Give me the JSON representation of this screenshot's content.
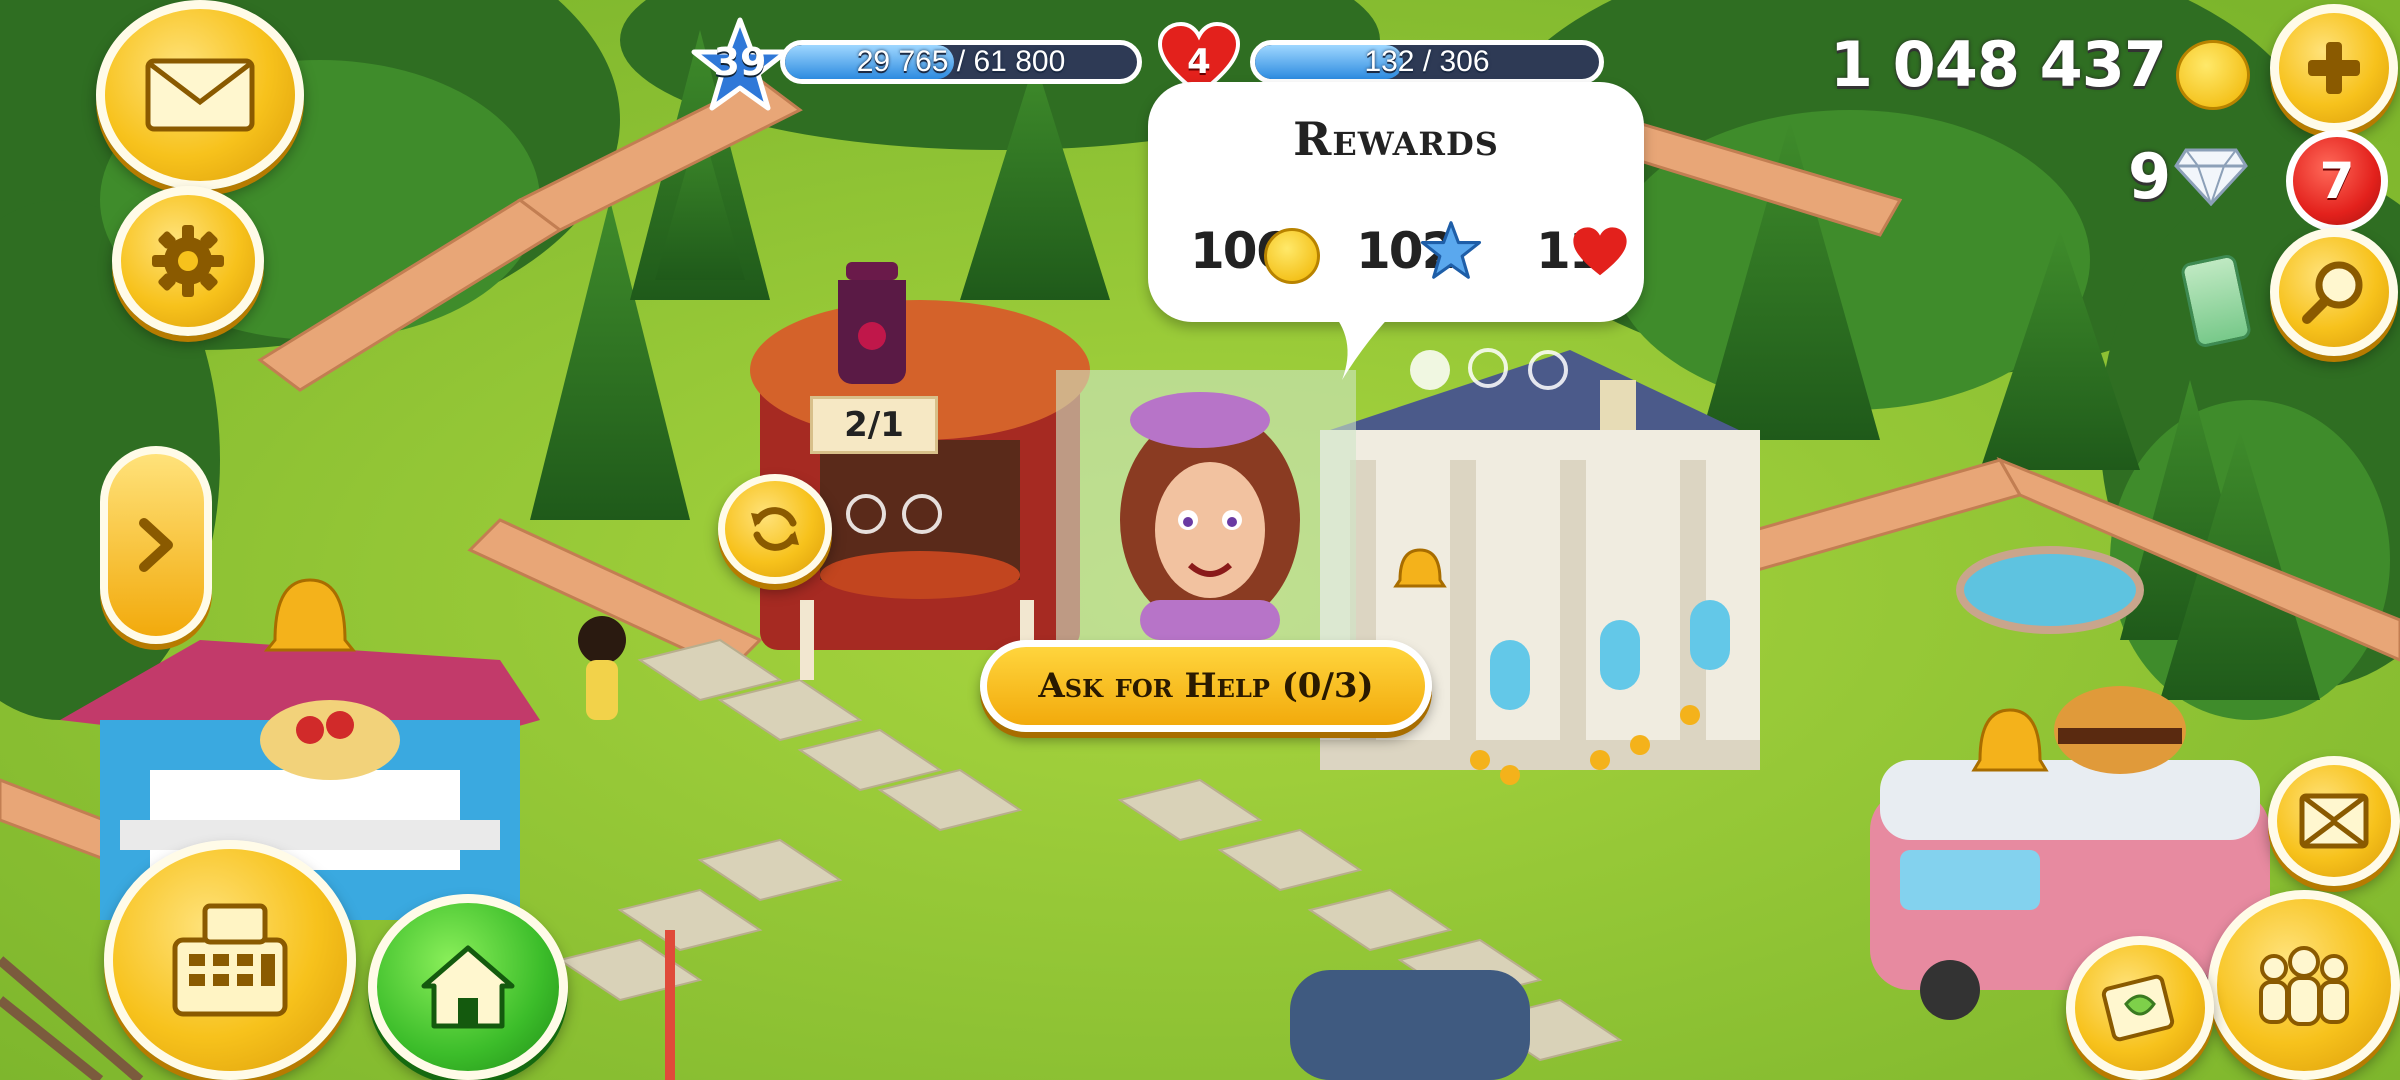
{
  "hud": {
    "level": "39",
    "xp": {
      "text": "29 765 / 61 800",
      "progress": 0.48
    },
    "hearts_level": "4",
    "hearts": {
      "text": "132 / 306",
      "progress": 0.43
    },
    "coins": "1 048 437",
    "diamonds": "9",
    "notification_count": "7"
  },
  "rewards_popup": {
    "title": "Rewards",
    "coins": "106",
    "xp": "102",
    "hearts": "11"
  },
  "order": {
    "recipe_count": "2/1",
    "ask_button_label": "Ask for Help (0/3)"
  },
  "colors": {
    "accent_yellow": "#f7c21c",
    "home_green": "#3cbd2a",
    "notification_red": "#e3211c",
    "bar_blue": "#2d8be0"
  },
  "icons": [
    "mail-icon",
    "gear-icon",
    "arrow-right-icon",
    "cash-register-icon",
    "home-icon",
    "plus-icon",
    "magnifier-icon",
    "expand-icon",
    "friends-icon",
    "refresh-icon",
    "star-icon",
    "heart-icon",
    "coin-icon",
    "diamond-icon",
    "bell-icon"
  ]
}
